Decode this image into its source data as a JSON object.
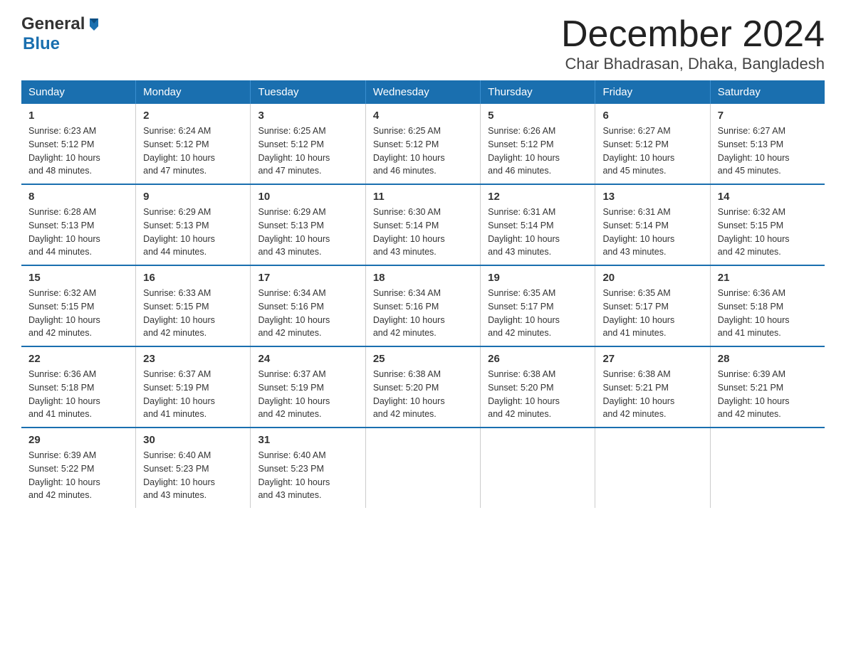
{
  "header": {
    "logo_general": "General",
    "logo_blue": "Blue",
    "month_title": "December 2024",
    "location": "Char Bhadrasan, Dhaka, Bangladesh"
  },
  "days_of_week": [
    "Sunday",
    "Monday",
    "Tuesday",
    "Wednesday",
    "Thursday",
    "Friday",
    "Saturday"
  ],
  "weeks": [
    [
      {
        "day": "1",
        "sunrise": "6:23 AM",
        "sunset": "5:12 PM",
        "daylight": "10 hours and 48 minutes."
      },
      {
        "day": "2",
        "sunrise": "6:24 AM",
        "sunset": "5:12 PM",
        "daylight": "10 hours and 47 minutes."
      },
      {
        "day": "3",
        "sunrise": "6:25 AM",
        "sunset": "5:12 PM",
        "daylight": "10 hours and 47 minutes."
      },
      {
        "day": "4",
        "sunrise": "6:25 AM",
        "sunset": "5:12 PM",
        "daylight": "10 hours and 46 minutes."
      },
      {
        "day": "5",
        "sunrise": "6:26 AM",
        "sunset": "5:12 PM",
        "daylight": "10 hours and 46 minutes."
      },
      {
        "day": "6",
        "sunrise": "6:27 AM",
        "sunset": "5:12 PM",
        "daylight": "10 hours and 45 minutes."
      },
      {
        "day": "7",
        "sunrise": "6:27 AM",
        "sunset": "5:13 PM",
        "daylight": "10 hours and 45 minutes."
      }
    ],
    [
      {
        "day": "8",
        "sunrise": "6:28 AM",
        "sunset": "5:13 PM",
        "daylight": "10 hours and 44 minutes."
      },
      {
        "day": "9",
        "sunrise": "6:29 AM",
        "sunset": "5:13 PM",
        "daylight": "10 hours and 44 minutes."
      },
      {
        "day": "10",
        "sunrise": "6:29 AM",
        "sunset": "5:13 PM",
        "daylight": "10 hours and 43 minutes."
      },
      {
        "day": "11",
        "sunrise": "6:30 AM",
        "sunset": "5:14 PM",
        "daylight": "10 hours and 43 minutes."
      },
      {
        "day": "12",
        "sunrise": "6:31 AM",
        "sunset": "5:14 PM",
        "daylight": "10 hours and 43 minutes."
      },
      {
        "day": "13",
        "sunrise": "6:31 AM",
        "sunset": "5:14 PM",
        "daylight": "10 hours and 43 minutes."
      },
      {
        "day": "14",
        "sunrise": "6:32 AM",
        "sunset": "5:15 PM",
        "daylight": "10 hours and 42 minutes."
      }
    ],
    [
      {
        "day": "15",
        "sunrise": "6:32 AM",
        "sunset": "5:15 PM",
        "daylight": "10 hours and 42 minutes."
      },
      {
        "day": "16",
        "sunrise": "6:33 AM",
        "sunset": "5:15 PM",
        "daylight": "10 hours and 42 minutes."
      },
      {
        "day": "17",
        "sunrise": "6:34 AM",
        "sunset": "5:16 PM",
        "daylight": "10 hours and 42 minutes."
      },
      {
        "day": "18",
        "sunrise": "6:34 AM",
        "sunset": "5:16 PM",
        "daylight": "10 hours and 42 minutes."
      },
      {
        "day": "19",
        "sunrise": "6:35 AM",
        "sunset": "5:17 PM",
        "daylight": "10 hours and 42 minutes."
      },
      {
        "day": "20",
        "sunrise": "6:35 AM",
        "sunset": "5:17 PM",
        "daylight": "10 hours and 41 minutes."
      },
      {
        "day": "21",
        "sunrise": "6:36 AM",
        "sunset": "5:18 PM",
        "daylight": "10 hours and 41 minutes."
      }
    ],
    [
      {
        "day": "22",
        "sunrise": "6:36 AM",
        "sunset": "5:18 PM",
        "daylight": "10 hours and 41 minutes."
      },
      {
        "day": "23",
        "sunrise": "6:37 AM",
        "sunset": "5:19 PM",
        "daylight": "10 hours and 41 minutes."
      },
      {
        "day": "24",
        "sunrise": "6:37 AM",
        "sunset": "5:19 PM",
        "daylight": "10 hours and 42 minutes."
      },
      {
        "day": "25",
        "sunrise": "6:38 AM",
        "sunset": "5:20 PM",
        "daylight": "10 hours and 42 minutes."
      },
      {
        "day": "26",
        "sunrise": "6:38 AM",
        "sunset": "5:20 PM",
        "daylight": "10 hours and 42 minutes."
      },
      {
        "day": "27",
        "sunrise": "6:38 AM",
        "sunset": "5:21 PM",
        "daylight": "10 hours and 42 minutes."
      },
      {
        "day": "28",
        "sunrise": "6:39 AM",
        "sunset": "5:21 PM",
        "daylight": "10 hours and 42 minutes."
      }
    ],
    [
      {
        "day": "29",
        "sunrise": "6:39 AM",
        "sunset": "5:22 PM",
        "daylight": "10 hours and 42 minutes."
      },
      {
        "day": "30",
        "sunrise": "6:40 AM",
        "sunset": "5:23 PM",
        "daylight": "10 hours and 43 minutes."
      },
      {
        "day": "31",
        "sunrise": "6:40 AM",
        "sunset": "5:23 PM",
        "daylight": "10 hours and 43 minutes."
      },
      null,
      null,
      null,
      null
    ]
  ],
  "labels": {
    "sunrise": "Sunrise:",
    "sunset": "Sunset:",
    "daylight": "Daylight:"
  }
}
